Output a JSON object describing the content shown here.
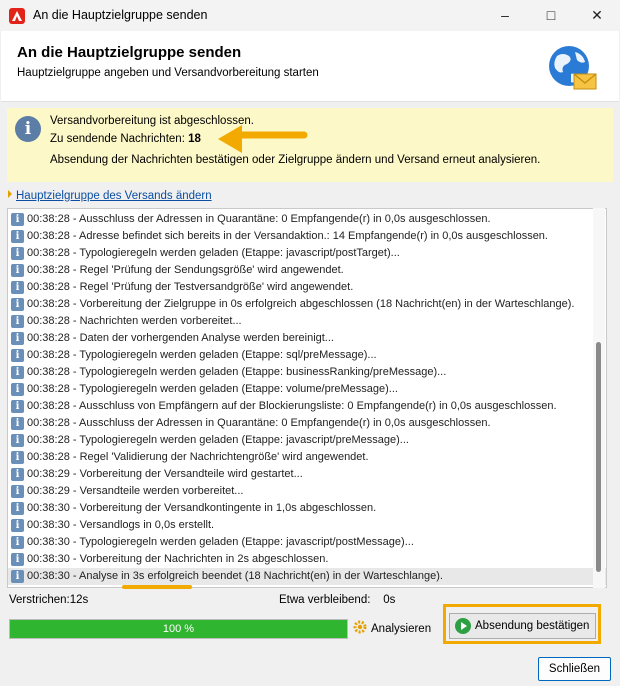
{
  "window": {
    "title": "An die Hauptzielgruppe senden"
  },
  "header": {
    "title": "An die Hauptzielgruppe senden",
    "subtitle": "Hauptzielgruppe angeben und Versandvorbereitung starten"
  },
  "info": {
    "line1": "Versandvorbereitung ist abgeschlossen.",
    "line2_label": "Zu sendende Nachrichten:",
    "line2_value": "18",
    "line3": "Absendung der Nachrichten bestätigen oder Zielgruppe ändern und Versand erneut analysieren."
  },
  "change_link": "Hauptzielgruppe des Versands ändern",
  "log": [
    "00:38:28 - Ausschluss der Adressen in Quarantäne: 0 Empfangende(r) in 0,0s ausgeschlossen.",
    "00:38:28 - Adresse befindet sich bereits in der Versandaktion.: 14 Empfangende(r) in 0,0s ausgeschlossen.",
    "00:38:28 - Typologieregeln werden geladen (Etappe: javascript/postTarget)...",
    "00:38:28 - Regel 'Prüfung der Sendungsgröße' wird angewendet.",
    "00:38:28 - Regel 'Prüfung der Testversandgröße' wird angewendet.",
    "00:38:28 - Vorbereitung der Zielgruppe in 0s erfolgreich abgeschlossen (18 Nachricht(en) in der Warteschlange).",
    "00:38:28 - Nachrichten werden vorbereitet...",
    "00:38:28 - Daten der vorhergenden Analyse werden bereinigt...",
    "00:38:28 - Typologieregeln werden geladen (Etappe: sql/preMessage)...",
    "00:38:28 - Typologieregeln werden geladen (Etappe: businessRanking/preMessage)...",
    "00:38:28 - Typologieregeln werden geladen (Etappe: volume/preMessage)...",
    "00:38:28 - Ausschluss von Empfängern auf der Blockierungsliste: 0 Empfangende(r) in 0,0s ausgeschlossen.",
    "00:38:28 - Ausschluss der Adressen in Quarantäne: 0 Empfangende(r) in 0,0s ausgeschlossen.",
    "00:38:28 - Typologieregeln werden geladen (Etappe: javascript/preMessage)...",
    "00:38:28 - Regel 'Validierung der Nachrichtengröße' wird angewendet.",
    "00:38:29 - Vorbereitung der Versandteile wird gestartet...",
    "00:38:29 - Versandteile werden vorbereitet...",
    "00:38:30 - Vorbereitung der Versandkontingente in 1,0s abgeschlossen.",
    "00:38:30 - Versandlogs in 0,0s erstellt.",
    "00:38:30 - Typologieregeln werden geladen (Etappe: javascript/postMessage)...",
    "00:38:30 - Vorbereitung der Nachrichten in 2s abgeschlossen.",
    "00:38:30 - Analyse in 3s erfolgreich beendet (18 Nachricht(en) in der Warteschlange)."
  ],
  "status": {
    "elapsed": "Verstrichen:12s",
    "remaining_label": "Etwa verbleibend:",
    "remaining_value": "0s",
    "progress_text": "100 %",
    "progress_fraction": 1.0
  },
  "buttons": {
    "analyze": "Analysieren",
    "confirm": "Absendung bestätigen",
    "close": "Schließen"
  },
  "icons": {
    "app": "adobe-icon",
    "info": "info-icon",
    "globe": "globe-mail-icon",
    "analyze": "gear-icon",
    "confirm": "play-icon"
  },
  "colors": {
    "info_bg": "#fdf8c7",
    "highlight": "#f2a900",
    "progress": "#2fb52f",
    "link": "#0b4ea2"
  }
}
